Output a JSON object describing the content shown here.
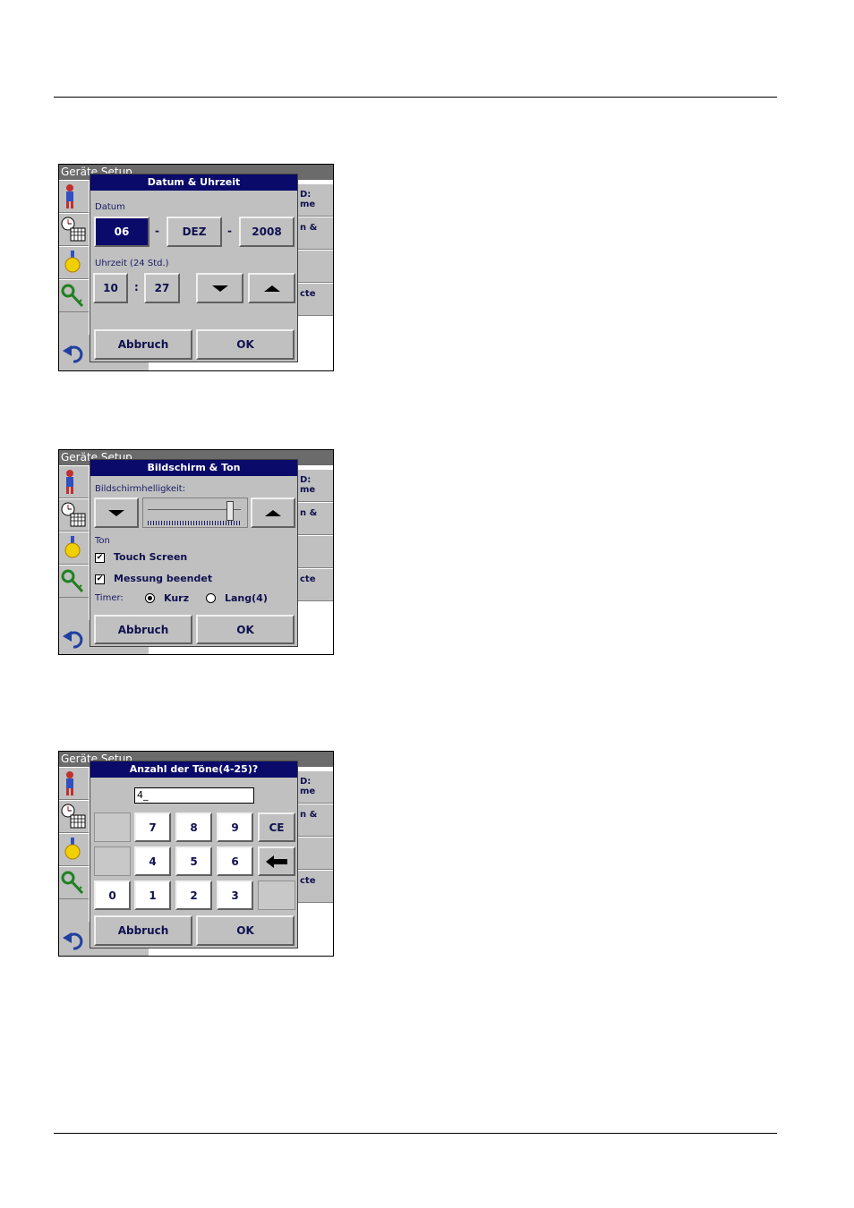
{
  "background_screen": {
    "title": "Geräte Setup",
    "right_labels": [
      "D:\nme",
      "n &",
      "",
      "cte"
    ]
  },
  "dialog_datetime": {
    "title": "Datum & Uhrzeit",
    "date_label": "Datum",
    "day": "06",
    "month": "DEZ",
    "year": "2008",
    "sep": "-",
    "time_label": "Uhrzeit (24 Std.)",
    "hour": "10",
    "minute": "27",
    "time_sep": ":",
    "cancel": "Abbruch",
    "ok": "OK"
  },
  "dialog_display": {
    "title": "Bildschirm & Ton",
    "brightness_label": "Bildschirmhelligkeit:",
    "brightness_level": 0.88,
    "sound_label": "Ton",
    "touch_screen": "Touch Screen",
    "measurement_done": "Messung beendet",
    "timer_label": "Timer:",
    "timer_short": "Kurz",
    "timer_long": "Lang(4)",
    "cancel": "Abbruch",
    "ok": "OK"
  },
  "dialog_tones": {
    "title": "Anzahl der Töne(4-25)?",
    "value": "4_",
    "keys": [
      "7",
      "8",
      "9",
      "CE",
      "4",
      "5",
      "6",
      "0",
      "1",
      "2",
      "3"
    ],
    "cancel": "Abbruch",
    "ok": "OK"
  }
}
